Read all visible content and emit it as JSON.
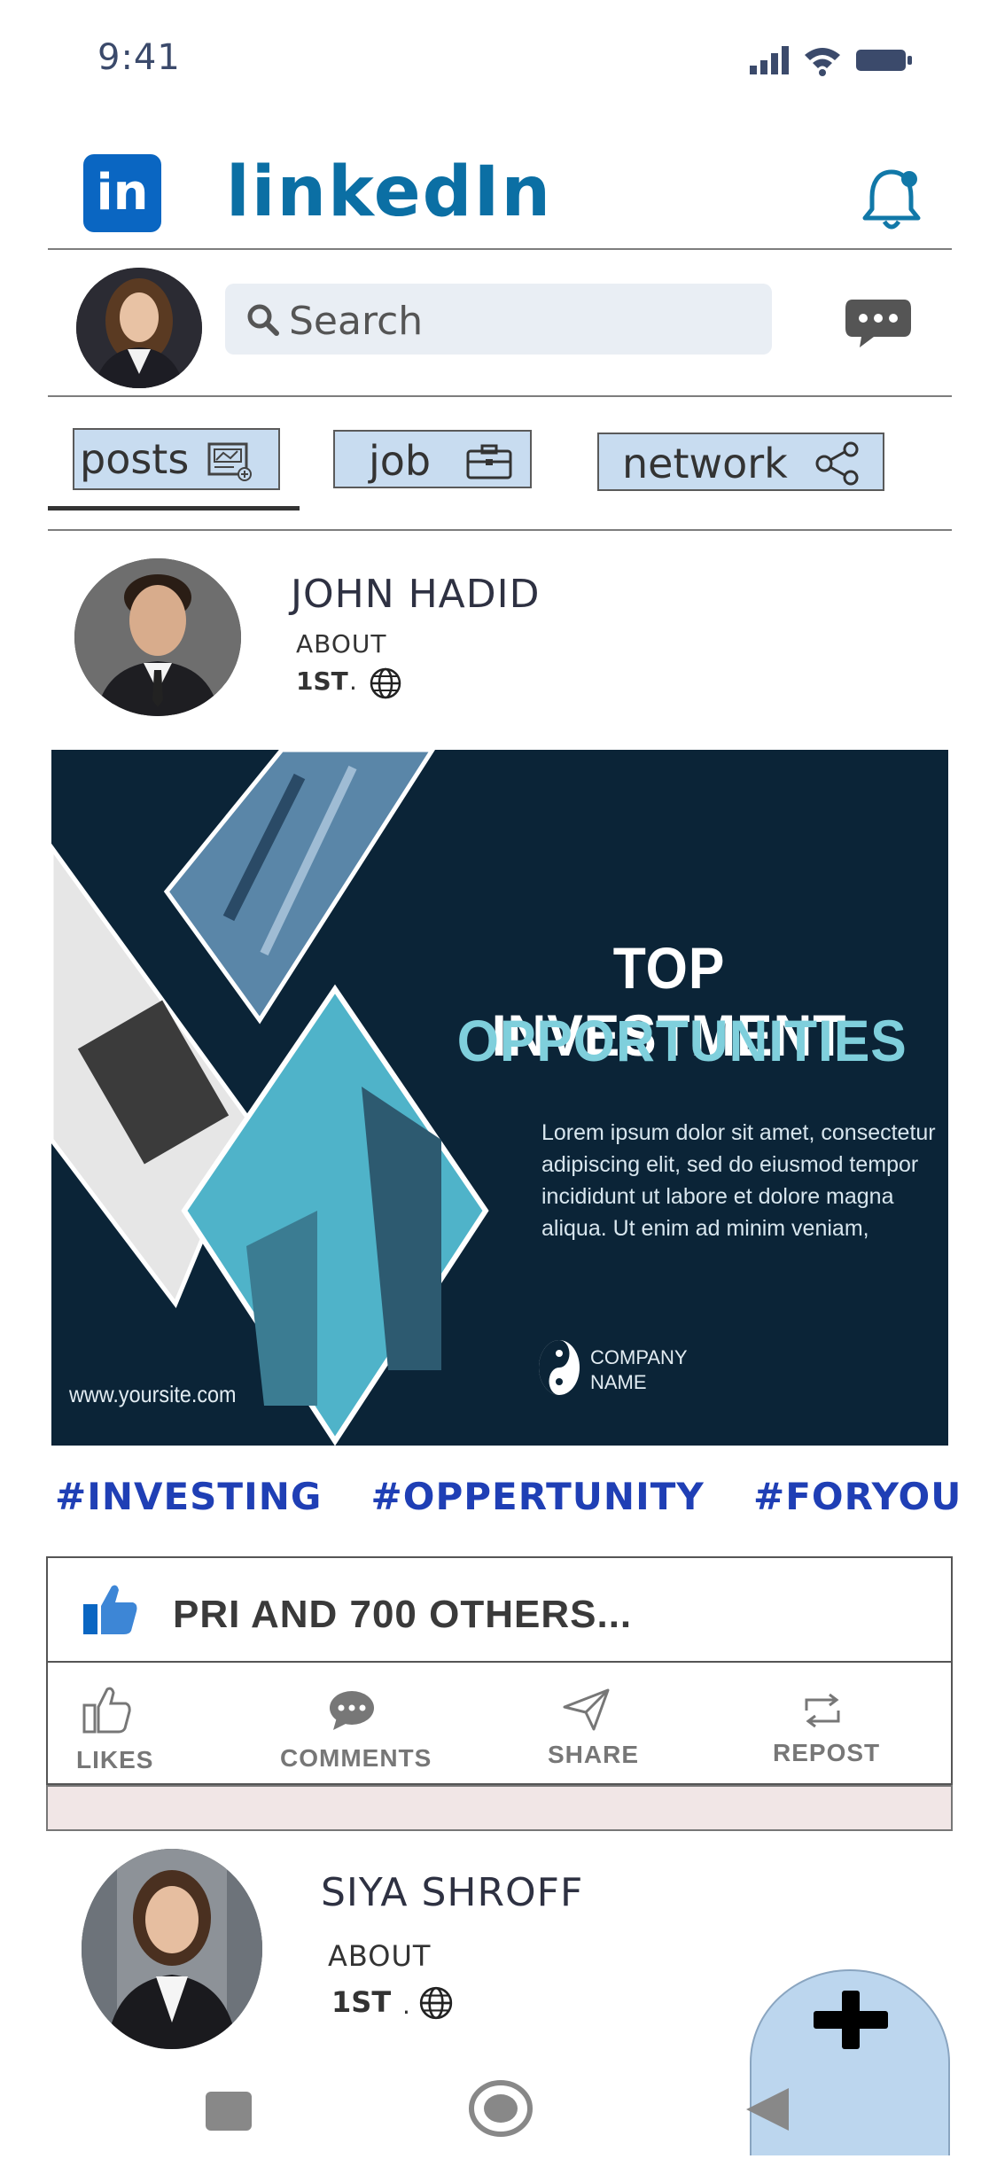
{
  "status_bar": {
    "time": "9:41"
  },
  "header": {
    "logo_text": "in",
    "title": "linkedIn"
  },
  "search": {
    "placeholder": "Search"
  },
  "tabs": [
    {
      "label": "posts"
    },
    {
      "label": "job"
    },
    {
      "label": "network"
    }
  ],
  "post": {
    "author": "JOHN HADID",
    "about": "ABOUT",
    "connection": "1ST",
    "dot": ".",
    "image": {
      "headline_1": "TOP INVESTMENT",
      "headline_2": "OPPORTUNITIES",
      "body_lines": [
        "Lorem ipsum dolor sit amet, consectetur",
        "adipiscing elit, sed do eiusmod tempor",
        "incididunt ut labore et dolore magna",
        "aliqua. Ut enim ad minim veniam,"
      ],
      "company_line_1": "COMPANY",
      "company_line_2": "NAME",
      "website": "www.yoursite.com"
    },
    "hashtags": "#INVESTING  #OPPERTUNITY  #FORYOU",
    "likes_summary": "PRI AND 700 OTHERS...",
    "actions": {
      "likes": "LIKES",
      "comments": "COMMENTS",
      "share": "SHARE",
      "repost": "REPOST"
    }
  },
  "next_post": {
    "author": "SIYA SHROFF",
    "about": "ABOUT",
    "connection": "1ST",
    "dot": "."
  },
  "colors": {
    "brand": "#0a66c2",
    "title": "#0b6fa4",
    "hashtag": "#1f3fb5",
    "tab_bg": "#c8dcf0",
    "image_bg": "#0b2437",
    "image_accent": "#7fcfdc"
  }
}
